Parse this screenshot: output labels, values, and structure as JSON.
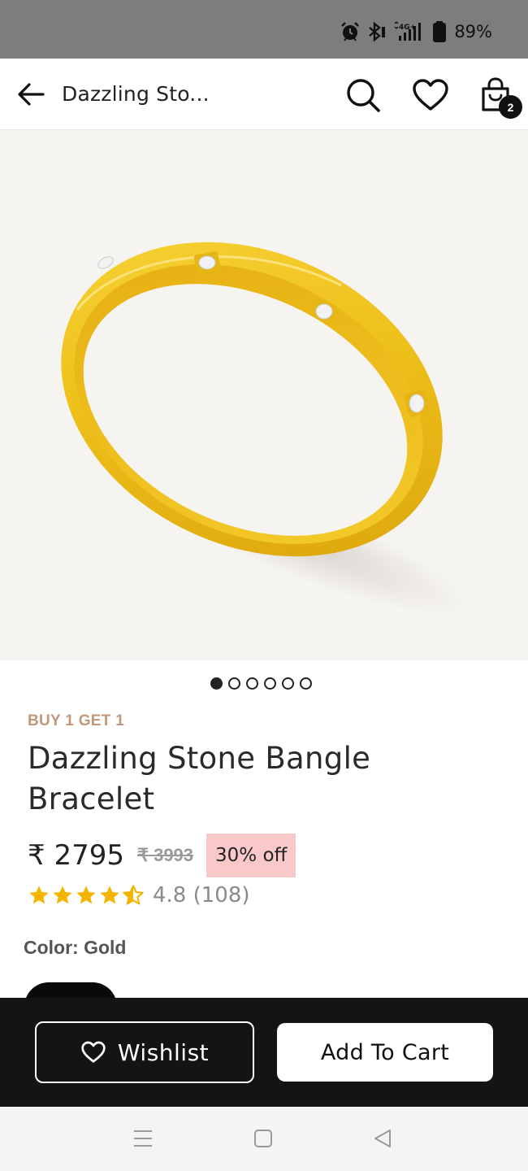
{
  "status_bar": {
    "network_label": "4G+",
    "battery_percent": "89%"
  },
  "header": {
    "title": "Dazzling Sto...",
    "cart_count": "2"
  },
  "gallery": {
    "image_count": 6,
    "active_index": 0
  },
  "product": {
    "promo_tag": "BUY 1 GET 1",
    "name": "Dazzling Stone Bangle Bracelet",
    "price": "₹ 2795",
    "mrp": "₹ 3993",
    "discount": "30% off",
    "rating_value": 4.8,
    "rating_text": "4.8 (108)",
    "color_label": "Color: Gold"
  },
  "actions": {
    "wishlist_label": "Wishlist",
    "add_to_cart_label": "Add To Cart"
  },
  "colors": {
    "promo": "#c0987c",
    "discount_bg": "#f9c9c9",
    "bar_dark": "#141414",
    "star": "#f5b400",
    "gold": "#f1c21a"
  },
  "icons": {
    "status": [
      "alarm-icon",
      "bluetooth-icon",
      "signal-icon",
      "battery-icon"
    ],
    "header": [
      "back-arrow-icon",
      "search-icon",
      "heart-icon",
      "shopping-bag-icon"
    ],
    "nav": [
      "recent-apps-icon",
      "home-icon",
      "back-triangle-icon"
    ]
  }
}
